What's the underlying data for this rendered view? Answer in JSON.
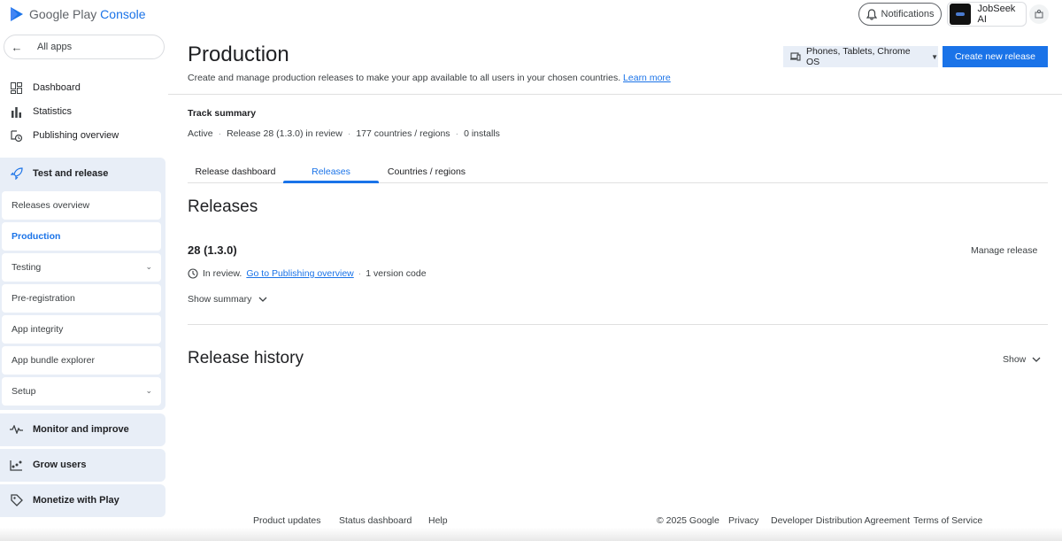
{
  "header": {
    "logo_google": "Google Play",
    "logo_console": "Console",
    "notifications_label": "Notifications",
    "app_name": "JobSeek AI"
  },
  "sidebar": {
    "all_apps": "All apps",
    "items": [
      {
        "label": "Dashboard",
        "icon": "dashboard-icon"
      },
      {
        "label": "Statistics",
        "icon": "bar-chart-icon"
      },
      {
        "label": "Publishing overview",
        "icon": "publishing-overview-icon"
      }
    ],
    "test_release": {
      "label": "Test and release",
      "icon": "rocket-icon",
      "children": [
        {
          "label": "Releases overview"
        },
        {
          "label": "Production",
          "active": true
        },
        {
          "label": "Testing",
          "expandable": true
        },
        {
          "label": "Pre-registration"
        },
        {
          "label": "App integrity"
        },
        {
          "label": "App bundle explorer"
        },
        {
          "label": "Setup",
          "expandable": true
        }
      ]
    },
    "groups": [
      {
        "label": "Monitor and improve",
        "icon": "monitor-icon"
      },
      {
        "label": "Grow users",
        "icon": "grow-users-icon"
      },
      {
        "label": "Monetize with Play",
        "icon": "tag-icon"
      }
    ]
  },
  "main": {
    "title": "Production",
    "description": "Create and manage production releases to make your app available to all users in your chosen countries.",
    "learn_more": "Learn more",
    "device_selector": "Phones, Tablets, Chrome OS",
    "create_release": "Create new release",
    "track_summary_title": "Track summary",
    "track_summary": {
      "status": "Active",
      "release": "Release 28 (1.3.0) in review",
      "countries": "177 countries / regions",
      "installs": "0 installs"
    },
    "tabs": [
      {
        "label": "Release dashboard",
        "active": false
      },
      {
        "label": "Releases",
        "active": true
      },
      {
        "label": "Countries / regions",
        "active": false
      }
    ],
    "releases_heading": "Releases",
    "release": {
      "version": "28 (1.3.0)",
      "manage_label": "Manage release",
      "status_text": "In review.",
      "status_link": "Go to Publishing overview",
      "version_codes": "1 version code",
      "show_summary": "Show summary"
    },
    "history_heading": "Release history",
    "history_show": "Show"
  },
  "footer": {
    "links_left": [
      "Product updates",
      "Status dashboard",
      "Help"
    ],
    "copyright": "© 2025 Google",
    "links_right": [
      "Privacy",
      "Developer Distribution Agreement",
      "Terms of Service"
    ]
  },
  "colors": {
    "accent": "#1a73e8",
    "nav_group_bg": "#e8eef7",
    "text": "#202124"
  }
}
